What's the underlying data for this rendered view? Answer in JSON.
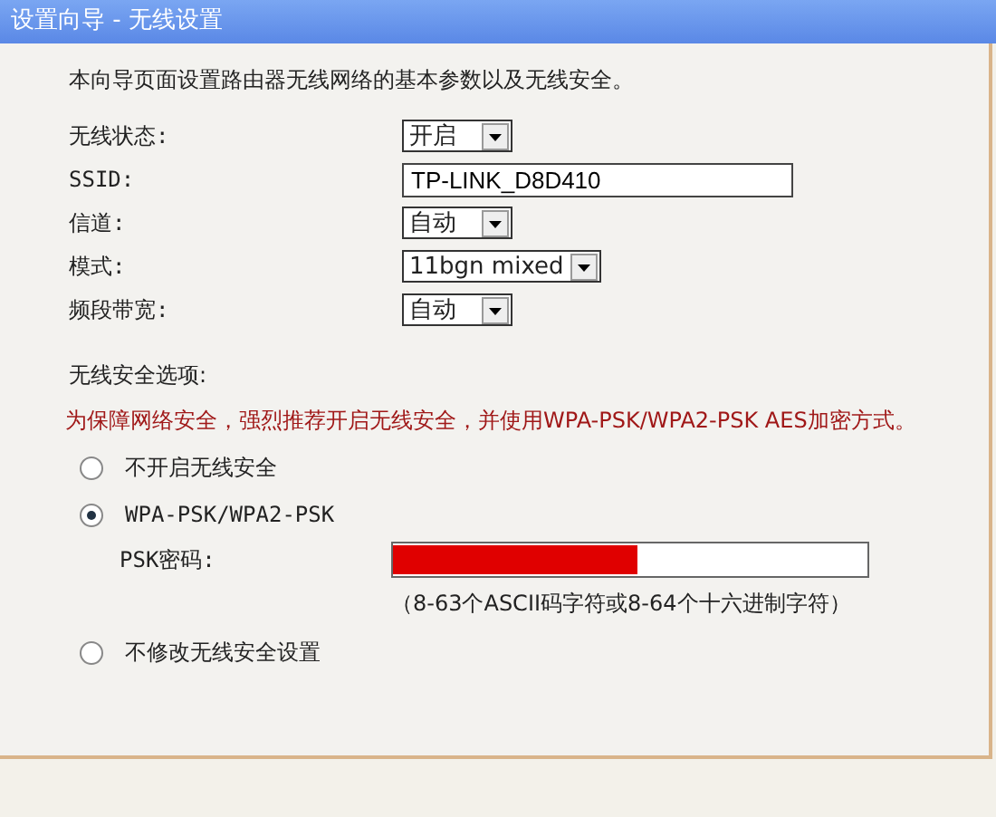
{
  "window": {
    "title": "设置向导 - 无线设置"
  },
  "intro": "本向导页面设置路由器无线网络的基本参数以及无线安全。",
  "fields": [
    {
      "kind": "select",
      "label": "无线状态:",
      "value": "开启"
    },
    {
      "kind": "text",
      "label": "SSID:",
      "value": "TP-LINK_D8D410"
    },
    {
      "kind": "select",
      "label": "信道:",
      "value": "自动"
    },
    {
      "kind": "select",
      "label": "模式:",
      "value": "11bgn mixed"
    },
    {
      "kind": "select",
      "label": "频段带宽:",
      "value": "自动"
    }
  ],
  "security": {
    "title": "无线安全选项:",
    "warning": "为保障网络安全，强烈推荐开启无线安全，并使用WPA-PSK/WPA2-PSK AES加密方式。",
    "options": [
      {
        "label": "不开启无线安全",
        "selected": false
      },
      {
        "label": "WPA-PSK/WPA2-PSK",
        "selected": true,
        "psk": {
          "label": "PSK密码:",
          "redacted": true,
          "hint": "（8-63个ASCII码字符或8-64个十六进制字符）"
        }
      },
      {
        "label": "不修改无线安全设置",
        "selected": false
      }
    ]
  }
}
